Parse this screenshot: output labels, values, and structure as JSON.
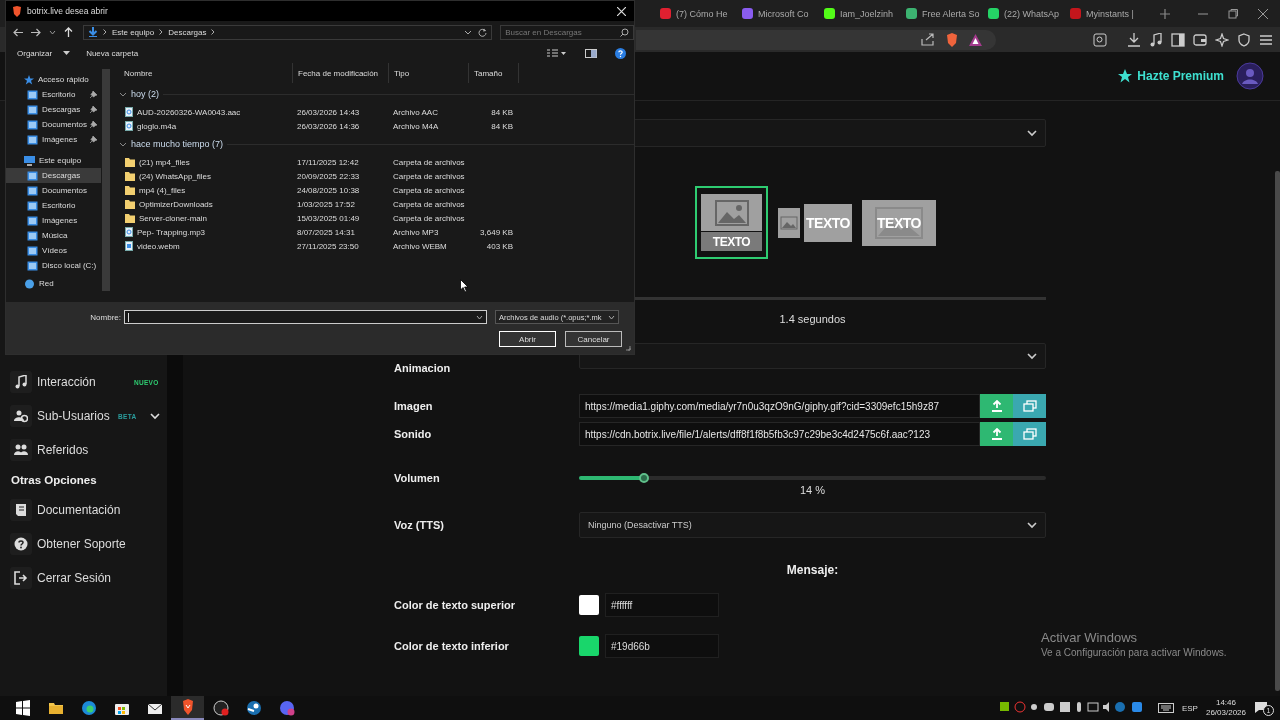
{
  "browser": {
    "tabs": [
      {
        "title": "(7) Cómo He",
        "selected": false,
        "color": "#e02030"
      },
      {
        "title": "Microsoft Co",
        "selected": false,
        "color": "#8a5cf0"
      },
      {
        "title": "Iam_Joelzinh",
        "selected": false,
        "color": "#53fc18"
      },
      {
        "title": "Free Alerta So",
        "selected": false,
        "color": "#3cb371"
      },
      {
        "title": "(22) WhatsAp",
        "selected": false,
        "color": "#25d366"
      },
      {
        "title": "Myinstants |",
        "selected": false,
        "color": "#c4161c"
      }
    ]
  },
  "header": {
    "premium": "Hazte Premium"
  },
  "sidebar": {
    "items": [
      {
        "label": "Interacción",
        "badge": "NUEVO",
        "color": "#2ecc71",
        "has_submenu": false
      },
      {
        "label": "Sub-Usuarios",
        "badge": "BETA",
        "color": "#2a9d9d",
        "has_submenu": true
      },
      {
        "label": "Referidos",
        "has_submenu": false
      }
    ],
    "section": "Otras Opciones",
    "more_items": [
      {
        "label": "Documentación"
      },
      {
        "label": "Obtener Soporte"
      },
      {
        "label": "Cerrar Sesión"
      }
    ]
  },
  "form": {
    "layouts": [
      {
        "label": "TEXTO",
        "kind": "stacked",
        "selected": true
      },
      {
        "label": "TEXTO",
        "kind": "side",
        "selected": false
      },
      {
        "label": "TEXTO",
        "kind": "overlay",
        "selected": false
      }
    ],
    "duration": "1.4 segundos",
    "animation": {
      "label": "Animacion"
    },
    "media": [
      {
        "label": "Imagen",
        "value": "https://media1.giphy.com/media/yr7n0u3qzO9nG/giphy.gif?cid=3309efc15h9z87"
      },
      {
        "label": "Sonido",
        "value": "https://cdn.botrix.live/file/1/alerts/dff8f1f8b5fb3c97c29be3c4d2475c6f.aac?123"
      }
    ],
    "volume": {
      "label": "Volumen",
      "level": 0.14,
      "reading": "14 %"
    },
    "tts": {
      "label": "Voz (TTS)",
      "value": "Ninguno (Desactivar TTS)"
    },
    "message_heading": "Mensaje:",
    "colors": [
      {
        "label": "Color de texto superior",
        "color": "#ffffff",
        "value": "#ffffff"
      },
      {
        "label": "Color de texto inferior",
        "color": "#19d66b",
        "value": "#19d66b"
      }
    ]
  },
  "dialog": {
    "title": "botrix.live desea abrir",
    "path": [
      "Este equipo",
      "Descargas"
    ],
    "search_placeholder": "Buscar en Descargas",
    "toolbar": {
      "organize": "Organizar",
      "new_folder": "Nueva carpeta"
    },
    "nav": [
      {
        "label": "Acceso rápido",
        "selected": false,
        "children": [
          {
            "label": "Escritorio",
            "pinned": true,
            "selected": false
          },
          {
            "label": "Descargas",
            "pinned": true,
            "selected": false
          },
          {
            "label": "Documentos",
            "pinned": true,
            "selected": false
          },
          {
            "label": "Imágenes",
            "pinned": true,
            "selected": false
          }
        ]
      },
      {
        "label": "Este equipo",
        "selected": false,
        "children": [
          {
            "label": "Descargas",
            "pinned": false,
            "selected": true
          },
          {
            "label": "Documentos",
            "pinned": false,
            "selected": false
          },
          {
            "label": "Escritorio",
            "pinned": false,
            "selected": false
          },
          {
            "label": "Imágenes",
            "pinned": false,
            "selected": false
          },
          {
            "label": "Música",
            "pinned": false,
            "selected": false
          },
          {
            "label": "Vídeos",
            "pinned": false,
            "selected": false
          },
          {
            "label": "Disco local (C:)",
            "pinned": false,
            "selected": false
          }
        ]
      },
      {
        "label": "Red",
        "selected": false
      }
    ],
    "columns": [
      "Nombre",
      "Fecha de modificación",
      "Tipo",
      "Tamaño"
    ],
    "groups": [
      {
        "label": "hoy (2)",
        "expanded": true,
        "files": [
          {
            "name": "AUD-20260326-WA0043.aac",
            "date": "26/03/2026 14:43",
            "type": "Archivo AAC",
            "size": "84 KB",
            "kind": "audio"
          },
          {
            "name": "gloglo.m4a",
            "date": "26/03/2026 14:36",
            "type": "Archivo M4A",
            "size": "84 KB",
            "kind": "audio"
          }
        ]
      },
      {
        "label": "hace mucho tiempo (7)",
        "expanded": true,
        "files": [
          {
            "name": "(21) mp4_files",
            "date": "17/11/2025 12:42",
            "type": "Carpeta de archivos",
            "kind": "folder"
          },
          {
            "name": "(24) WhatsApp_files",
            "date": "20/09/2025 22:33",
            "type": "Carpeta de archivos",
            "kind": "folder"
          },
          {
            "name": "mp4 (4)_files",
            "date": "24/08/2025 10:38",
            "type": "Carpeta de archivos",
            "kind": "folder"
          },
          {
            "name": "OptimizerDownloads",
            "date": "1/03/2025 17:52",
            "type": "Carpeta de archivos",
            "kind": "folder"
          },
          {
            "name": "Server-cloner-main",
            "date": "15/03/2025 01:49",
            "type": "Carpeta de archivos",
            "kind": "folder"
          },
          {
            "name": "Pep- Trapping.mp3",
            "date": "8/07/2025 14:31",
            "type": "Archivo MP3",
            "size": "3,649 KB",
            "kind": "audio"
          },
          {
            "name": "video.webm",
            "date": "27/11/2025 23:50",
            "type": "Archivo WEBM",
            "size": "403 KB",
            "kind": "video"
          }
        ]
      }
    ],
    "filename_label": "Nombre:",
    "filter": "Archivos de audio (*.opus;*.mk",
    "open": "Abrir",
    "cancel": "Cancelar"
  },
  "taskbar": {
    "apps": [
      {
        "selected": false
      },
      {
        "selected": false
      },
      {
        "selected": false
      },
      {
        "selected": false
      },
      {
        "selected": false
      },
      {
        "selected": true
      },
      {
        "selected": false
      },
      {
        "selected": false
      },
      {
        "selected": false
      }
    ],
    "language": "ESP",
    "time": "14:46",
    "date": "26/03/2026",
    "notifications": "1"
  },
  "activation": {
    "title": "Activar Windows",
    "subtitle": "Ve a Configuración para activar Windows."
  }
}
